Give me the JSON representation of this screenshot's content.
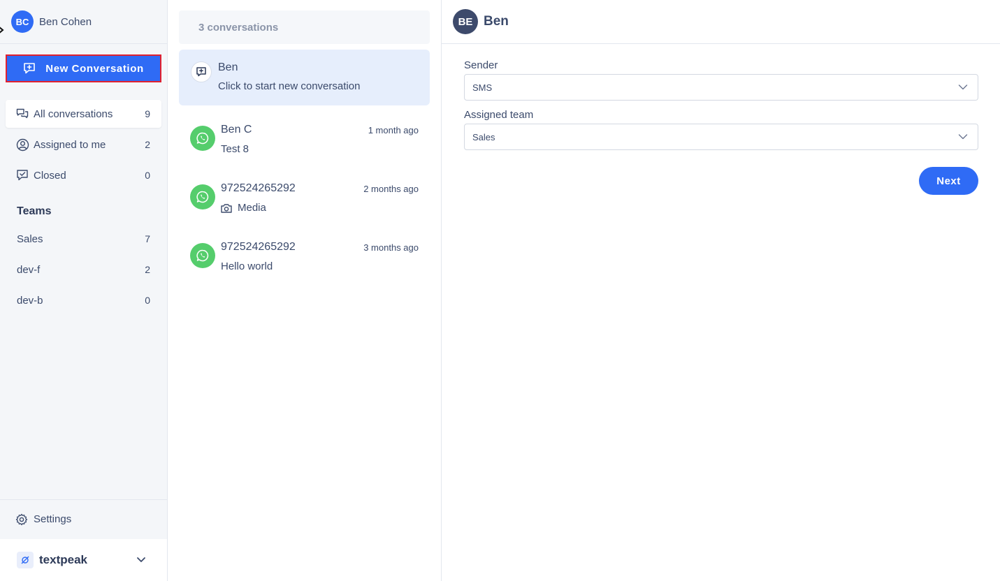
{
  "colors": {
    "accent": "#2f6bf5",
    "highlight_border": "#e0202f",
    "whatsapp": "#55cd6c",
    "selected_bg": "#e6eefc"
  },
  "profile": {
    "initials": "BC",
    "name": "Ben Cohen"
  },
  "sidebar": {
    "new_conversation_label": "New Conversation",
    "nav": [
      {
        "label": "All conversations",
        "count": "9",
        "icon": "chat-bubbles-icon"
      },
      {
        "label": "Assigned to me",
        "count": "2",
        "icon": "user-circle-icon"
      },
      {
        "label": "Closed",
        "count": "0",
        "icon": "chat-check-icon"
      }
    ],
    "teams_title": "Teams",
    "teams": [
      {
        "label": "Sales",
        "count": "7"
      },
      {
        "label": "dev-f",
        "count": "2"
      },
      {
        "label": "dev-b",
        "count": "0"
      }
    ],
    "settings_label": "Settings",
    "brand_name": "textpeak"
  },
  "conversations": {
    "header": "3 conversations",
    "new_item": {
      "name": "Ben",
      "subtitle": "Click to start new conversation"
    },
    "items": [
      {
        "name": "Ben C",
        "time": "1 month ago",
        "preview": "Test 8",
        "channel_icon": "whatsapp-icon"
      },
      {
        "name": "972524265292",
        "time": "2 months ago",
        "preview": "Media",
        "preview_icon": "camera-icon",
        "channel_icon": "whatsapp-icon"
      },
      {
        "name": "972524265292",
        "time": "3 months ago",
        "preview": "Hello world",
        "channel_icon": "whatsapp-icon"
      }
    ]
  },
  "main": {
    "avatar_initials": "BE",
    "title": "Ben",
    "sender_label": "Sender",
    "sender_value": "SMS",
    "team_label": "Assigned team",
    "team_value": "Sales",
    "next_label": "Next"
  }
}
